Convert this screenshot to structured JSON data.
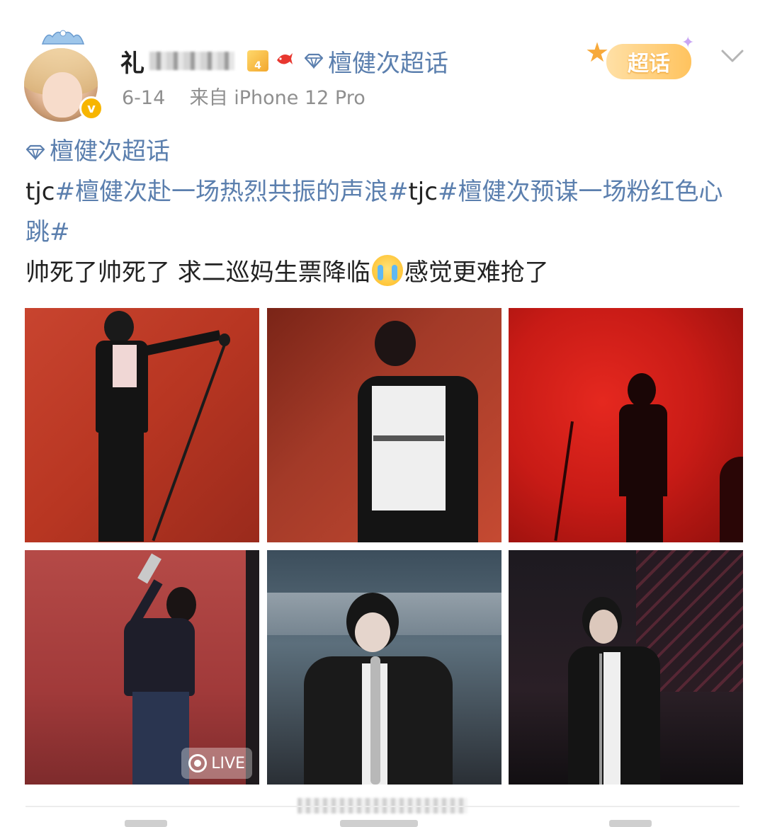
{
  "post": {
    "username": "礼",
    "timestamp": "6-14",
    "source": "来自 iPhone 12 Pro",
    "header_topic": "檀健次超话",
    "chaohua_badge": "超话",
    "verified_mark": "v",
    "level_mark": "4"
  },
  "content": {
    "topic_link": "檀健次超话",
    "line1_prefix": "tjc",
    "hashtag1": "#檀健次赴一场热烈共振的声浪#",
    "line1_mid": "tjc",
    "hashtag2": "#檀健次预谋一场粉红色心跳#",
    "body_text_1": "帅死了帅死了 求二巡妈生票降临",
    "body_text_2": "感觉更难抢了"
  },
  "media": {
    "photo_count": 6,
    "live_label": "LIVE"
  },
  "colors": {
    "link": "#5b7fae",
    "text": "#222222",
    "meta": "#8f8f8f",
    "badge_gold": "#f7b500"
  },
  "icons": [
    "avatar-crown-icon",
    "verified-icon",
    "level-icon",
    "fish-icon",
    "diamond-icon",
    "chaohua-star-icon",
    "chevron-down-icon",
    "cry-emoji-icon",
    "live-icon"
  ]
}
